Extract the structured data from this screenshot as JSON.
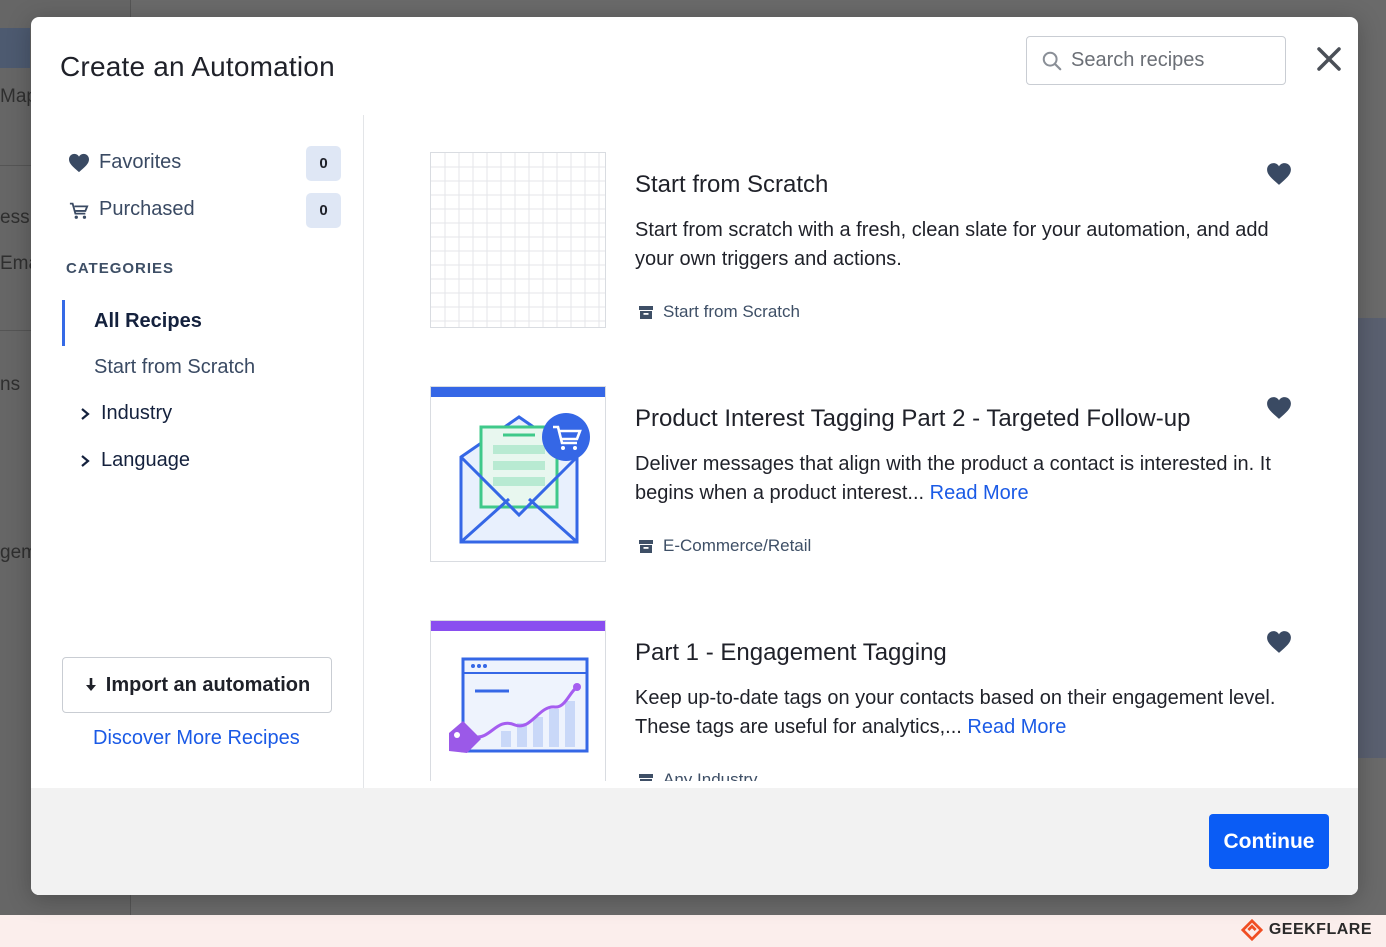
{
  "background": {
    "texts": [
      "Map",
      "ess",
      "Ema",
      "ns",
      "gem"
    ]
  },
  "modal": {
    "title": "Create an Automation",
    "search_placeholder": "Search recipes"
  },
  "sidebar": {
    "favorites_label": "Favorites",
    "favorites_count": "0",
    "purchased_label": "Purchased",
    "purchased_count": "0",
    "categories_heading": "CATEGORIES",
    "categories": [
      {
        "label": "All Recipes",
        "active": true
      },
      {
        "label": "Start from Scratch"
      },
      {
        "label": "Industry",
        "expandable": true
      },
      {
        "label": "Language",
        "expandable": true
      }
    ],
    "import_label": "Import an automation",
    "discover_label": "Discover More Recipes"
  },
  "recipes": [
    {
      "title": "Start from Scratch",
      "description": "Start from scratch with a fresh, clean slate for your automation, and add your own triggers and actions.",
      "read_more": "",
      "tag": "Start from Scratch"
    },
    {
      "title": "Product Interest Tagging Part 2 - Targeted Follow-up",
      "description": "Deliver messages that align with the product a contact is interested in. It begins when a product interest...",
      "read_more": "Read More",
      "tag": "E-Commerce/Retail"
    },
    {
      "title": "Part 1 - Engagement Tagging",
      "description": "Keep up-to-date tags on your contacts based on their engagement level. These tags are useful for analytics,...",
      "read_more": "Read More",
      "tag": "Any Industry"
    }
  ],
  "footer": {
    "continue_label": "Continue"
  },
  "watermark": {
    "brand": "GEEKFLARE"
  },
  "colors": {
    "accent": "#0a5cf5",
    "link": "#1a5ae6",
    "heart": "#3a4a63",
    "badge_bg": "#dfe7f5"
  }
}
